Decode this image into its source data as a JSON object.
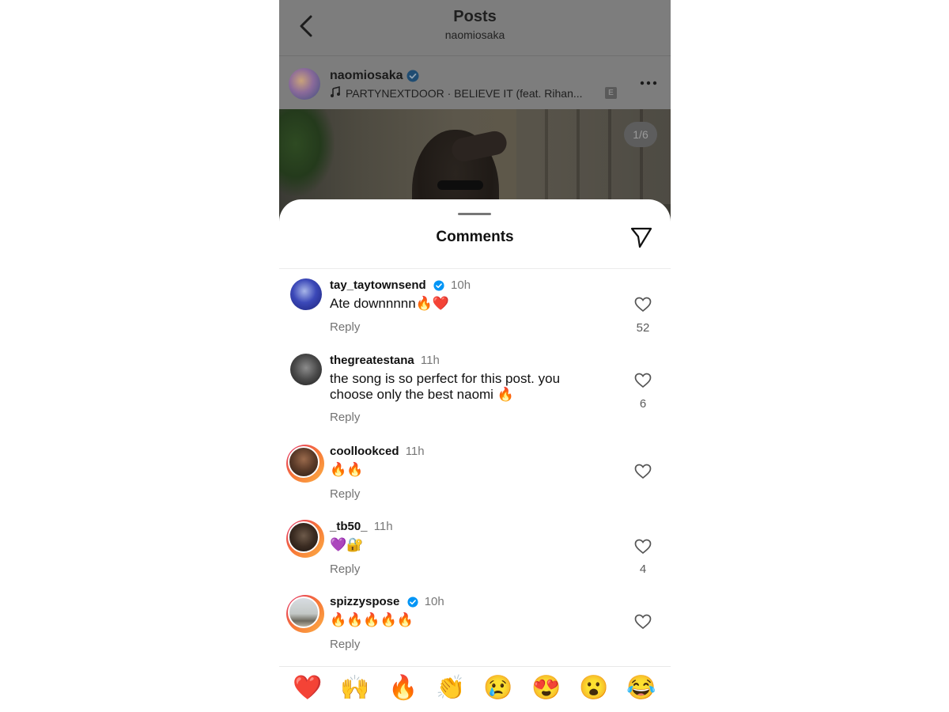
{
  "nav": {
    "title": "Posts",
    "subtitle": "naomiosaka"
  },
  "post": {
    "username": "naomiosaka",
    "verified": true,
    "music": "PARTYNEXTDOOR · BELIEVE IT (feat. Rihan...",
    "explicit_label": "E",
    "image_counter": "1/6"
  },
  "comments_sheet": {
    "title": "Comments",
    "comments": [
      {
        "user": "tay_taytownsend",
        "verified": true,
        "time": "10h",
        "text": "Ate downnnnn🔥❤️",
        "reply_label": "Reply",
        "likes": "52"
      },
      {
        "user": "thegreatestana",
        "verified": false,
        "time": "11h",
        "text": "the song is so perfect for this post. you choose only the best naomi 🔥",
        "reply_label": "Reply",
        "likes": "6"
      },
      {
        "user": "coollookced",
        "verified": false,
        "time": "11h",
        "text": "🔥🔥",
        "reply_label": "Reply",
        "likes": ""
      },
      {
        "user": "_tb50_",
        "verified": false,
        "time": "11h",
        "text": "💜🔐",
        "reply_label": "Reply",
        "likes": "4"
      },
      {
        "user": "spizzyspose",
        "verified": true,
        "time": "10h",
        "text": "🔥🔥🔥🔥🔥",
        "reply_label": "Reply",
        "likes": ""
      }
    ]
  },
  "reactions": [
    "❤️",
    "🙌",
    "🔥",
    "👏",
    "😢",
    "😍",
    "😮",
    "😂"
  ],
  "colors": {
    "verified": "#0095f6",
    "story_ring_start": "#e1306c",
    "story_ring_end": "#fcaf45",
    "secondary_text": "#737373"
  }
}
